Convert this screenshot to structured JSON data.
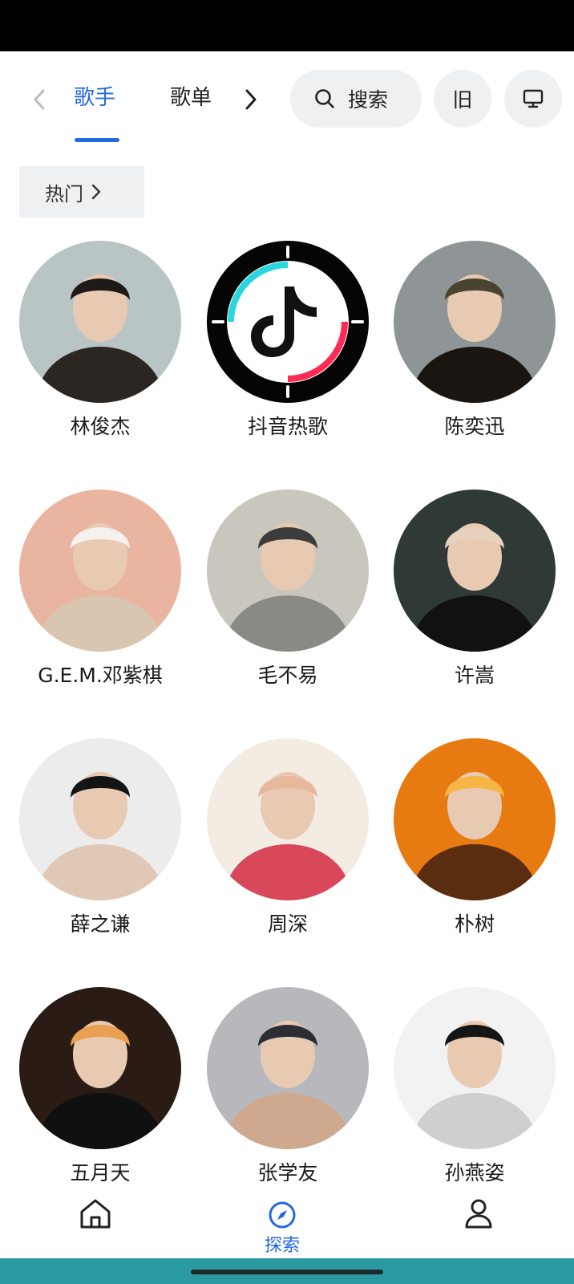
{
  "tabs": [
    {
      "label": "歌手",
      "active": true
    },
    {
      "label": "歌单",
      "active": false
    }
  ],
  "search": {
    "label": "搜索"
  },
  "old_button": {
    "label": "旧"
  },
  "filter_chip": {
    "label": "热门"
  },
  "artists": [
    {
      "name": "林俊杰",
      "avatar_colors": [
        "#b9c4c4",
        "#f4f4f2",
        "#2b2622"
      ]
    },
    {
      "name": "抖音热歌",
      "avatar_colors": [
        "#050505",
        "#ff2a55",
        "#29d6e0"
      ]
    },
    {
      "name": "陈奕迅",
      "avatar_colors": [
        "#8f9596",
        "#4a4330",
        "#1a1510"
      ]
    },
    {
      "name": "G.E.M.邓紫棋",
      "avatar_colors": [
        "#e9b4a0",
        "#f6f1ee",
        "#d9c6b0"
      ]
    },
    {
      "name": "毛不易",
      "avatar_colors": [
        "#c9c6be",
        "#3c3c3c",
        "#8a8a84"
      ]
    },
    {
      "name": "许嵩",
      "avatar_colors": [
        "#2f3a36",
        "#e7d2c0",
        "#111111"
      ]
    },
    {
      "name": "薛之谦",
      "avatar_colors": [
        "#ececec",
        "#141414",
        "#e0c8b6"
      ]
    },
    {
      "name": "周深",
      "avatar_colors": [
        "#f2ece3",
        "#e6b99e",
        "#d8485a"
      ]
    },
    {
      "name": "朴树",
      "avatar_colors": [
        "#e87a12",
        "#f6b544",
        "#5a2d10"
      ]
    },
    {
      "name": "五月天",
      "avatar_colors": [
        "#2a1c14",
        "#e9a050",
        "#101010"
      ]
    },
    {
      "name": "张学友",
      "avatar_colors": [
        "#b8b8bc",
        "#2c2c34",
        "#cfa890"
      ]
    },
    {
      "name": "孙燕姿",
      "avatar_colors": [
        "#f2f2f2",
        "#151515",
        "#cfcfcf"
      ]
    }
  ],
  "bottom_nav": {
    "explore_label": "探索"
  },
  "colors": {
    "accent": "#2468e0",
    "pill_bg": "#eef0f2",
    "gesture_bar": "#2a9aa0"
  }
}
